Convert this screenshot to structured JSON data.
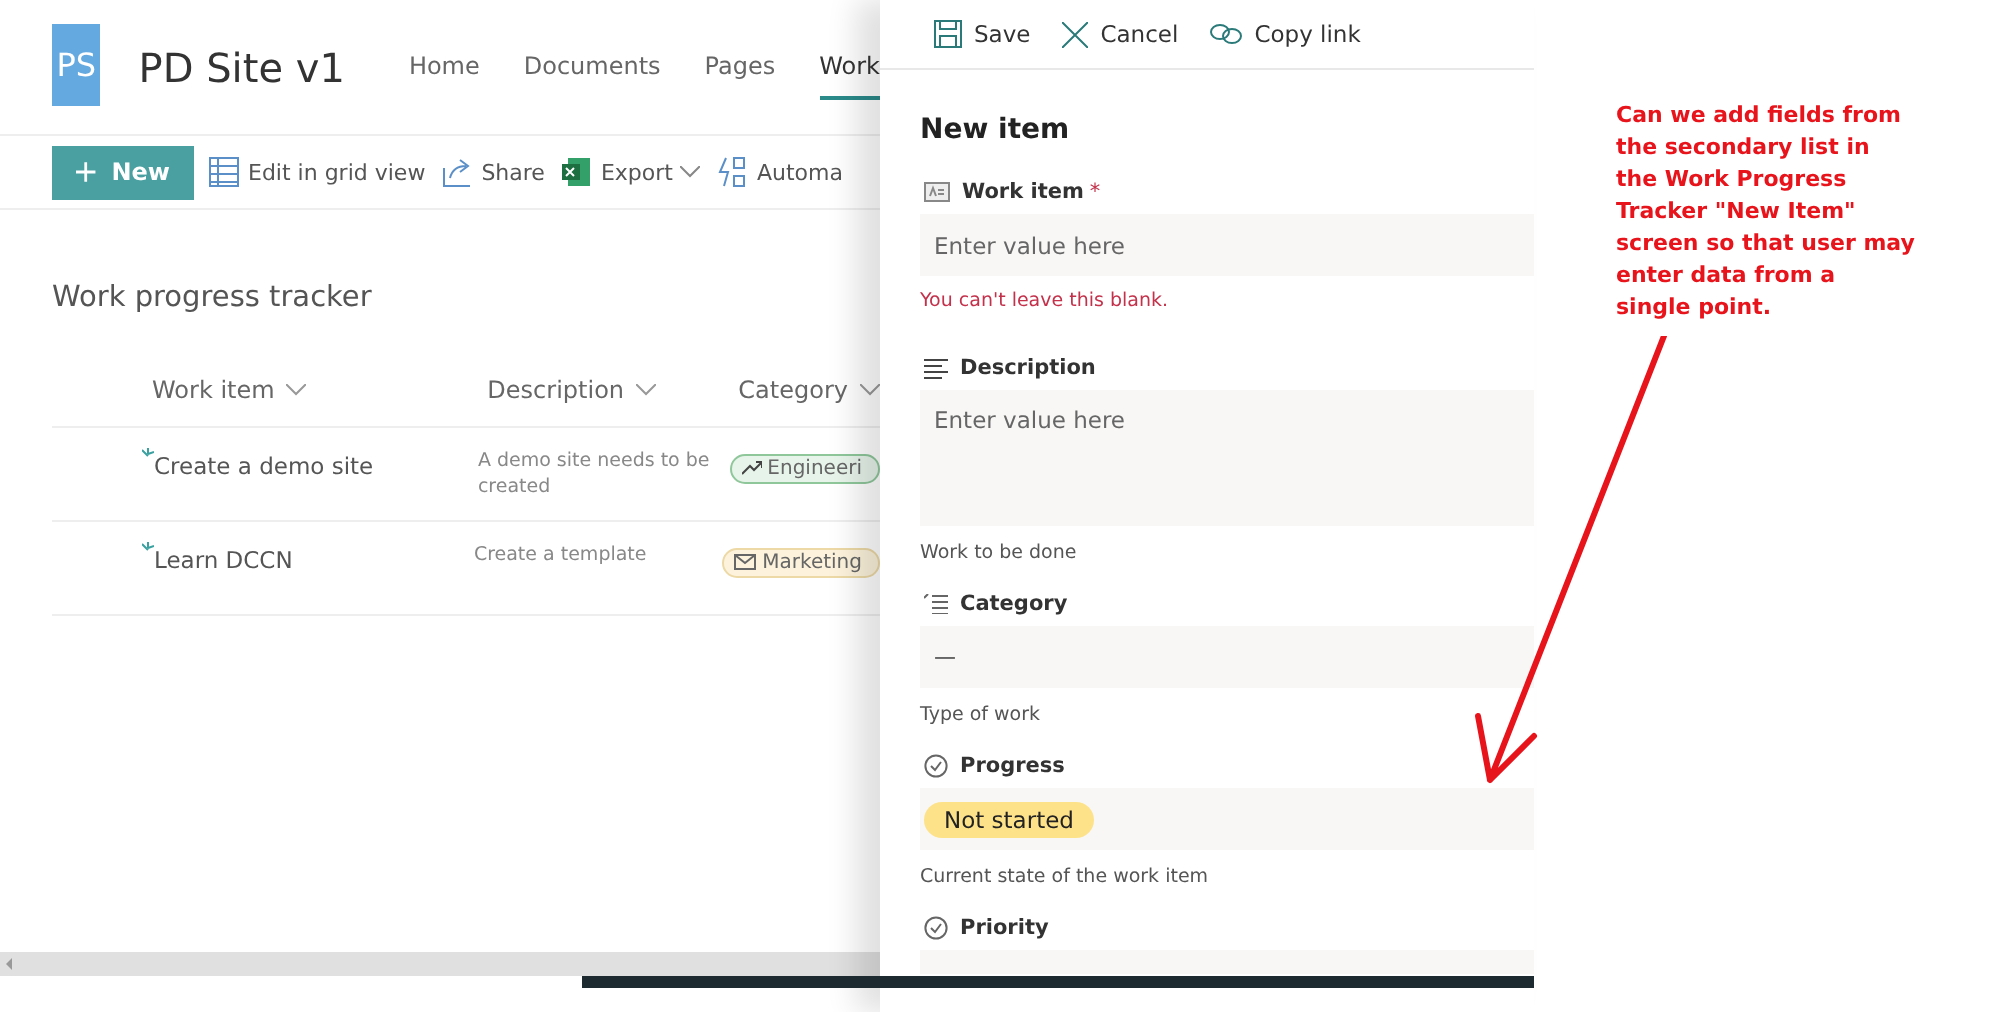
{
  "site": {
    "logo": "PS",
    "title": "PD Site v1",
    "nav": [
      {
        "label": "Home",
        "selected": false
      },
      {
        "label": "Documents",
        "selected": false
      },
      {
        "label": "Pages",
        "selected": false
      },
      {
        "label": "Work",
        "selected": true
      }
    ]
  },
  "commands": [
    {
      "kind": "primary",
      "label": "New"
    },
    {
      "kind": "grid",
      "label": "Edit in grid view"
    },
    {
      "kind": "share",
      "label": "Share"
    },
    {
      "kind": "excel",
      "label": "Export",
      "dropdown": true
    },
    {
      "kind": "flow",
      "label": "Automa"
    }
  ],
  "list": {
    "title": "Work progress tracker",
    "columns": [
      "Work item",
      "Description",
      "Category"
    ],
    "rows": [
      {
        "title": "Create a demo site",
        "description": "A demo site needs to be created",
        "category": "Engineeri",
        "kind": "engineering"
      },
      {
        "title": "Learn DCCN",
        "description": "Create a template",
        "category": "Marketing",
        "kind": "marketing"
      }
    ]
  },
  "panel": {
    "toolbar": [
      {
        "kind": "save",
        "label": "Save"
      },
      {
        "kind": "cancel",
        "label": "Cancel"
      },
      {
        "kind": "link",
        "label": "Copy link"
      }
    ],
    "title": "New item",
    "fields": [
      {
        "kind": "text",
        "label": "Work item",
        "required_mark": "*",
        "placeholder": "Enter value here",
        "error": "You can't leave this blank."
      },
      {
        "kind": "multiline",
        "label": "Description",
        "placeholder": "Enter value here",
        "hint": "Work to be done"
      },
      {
        "kind": "choice",
        "label": "Category",
        "value": "—",
        "hint": "Type of work"
      },
      {
        "kind": "status",
        "label": "Progress",
        "pill": "Not started",
        "hint": "Current state of the work item"
      },
      {
        "kind": "status",
        "label": "Priority"
      }
    ]
  },
  "annotation": {
    "text": "Can we add fields from the secondary list in the Work Progress Tracker \"New Item\" screen so that user may enter data from a single point."
  }
}
